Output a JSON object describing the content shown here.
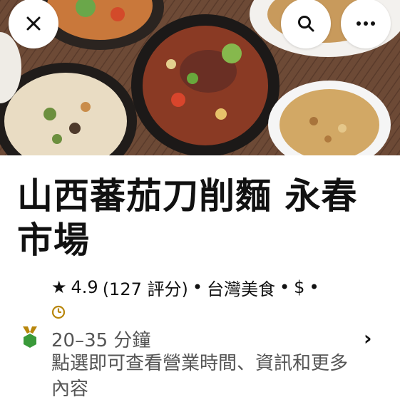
{
  "header": {
    "close_icon": "close-icon",
    "search_icon": "search-icon",
    "more_icon": "more-icon"
  },
  "store": {
    "name": "山西蕃茄刀削麵 永春市場",
    "rating": "4.9",
    "review_count": "(127 評分)",
    "cuisine": "台灣美食",
    "price": "$",
    "separator": "•"
  },
  "delivery": {
    "time": "20–35 分鐘",
    "info": "點選即可查看營業時間、資訊和更多內容"
  },
  "colors": {
    "accent_green": "#3a9a3a",
    "accent_gold": "#b8860b",
    "muted_text": "#555555"
  }
}
